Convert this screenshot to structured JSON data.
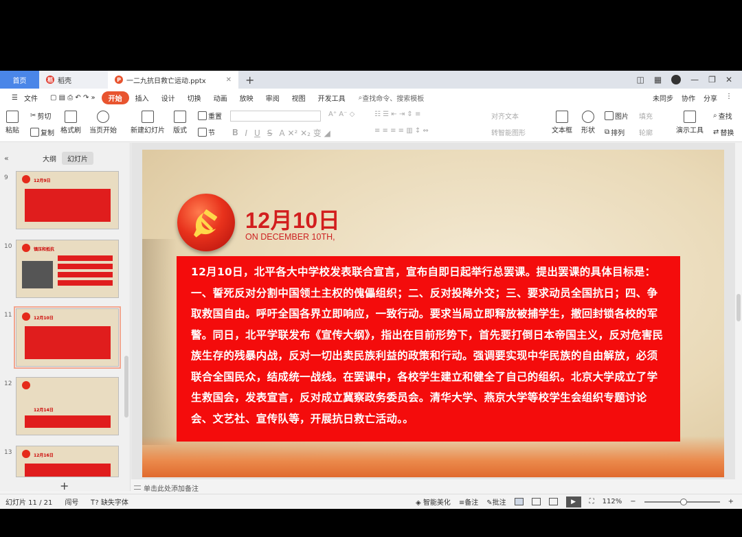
{
  "tabbar": {
    "home": "首页",
    "docer": "稻壳",
    "document": "一二九抗日救亡运动.pptx",
    "plus": "+"
  },
  "menubar": {
    "file": "文件",
    "items": [
      "开始",
      "插入",
      "设计",
      "切换",
      "动画",
      "放映",
      "审阅",
      "视图",
      "开发工具"
    ],
    "search": "查找命令、搜索模板",
    "sync": "未同步",
    "collab": "协作",
    "share": "分享"
  },
  "ribbon": {
    "paste": "粘贴",
    "cut": "剪切",
    "copy": "复制",
    "format_painter": "格式刷",
    "start_from_current": "当页开始",
    "new_slide": "新建幻灯片",
    "layout": "版式",
    "reset": "重置",
    "section": "节",
    "text_direction": "文本框",
    "align_text": "对齐文本",
    "smartart": "转智能图形",
    "textbox": "文本框",
    "shape": "形状",
    "picture": "图片",
    "fill": "填充",
    "arrange": "排列",
    "outline": "轮廓",
    "presentation_tools": "演示工具",
    "find": "查找",
    "replace": "替换"
  },
  "left_panel": {
    "outline_tab": "大纲",
    "slides_tab": "幻灯片",
    "thumbnails": [
      {
        "num": "9",
        "title": "12月9日"
      },
      {
        "num": "10",
        "title": "镇压和抵抗"
      },
      {
        "num": "11",
        "title": "12月10日"
      },
      {
        "num": "12",
        "title": "12月14日"
      },
      {
        "num": "13",
        "title": "12月16日"
      }
    ],
    "add": "+"
  },
  "slide": {
    "date": "12月10日",
    "subtitle": "ON DECEMBER 10TH,",
    "body": "12月10日，北平各大中学校发表联合宣言，宣布自即日起举行总罢课。提出罢课的具体目标是：一、誓死反对分割中国领土主权的傀儡组织；二、反对投降外交；三、要求动员全国抗日；四、争取救国自由。呼吁全国各界立即响应，一致行动。要求当局立即释放被捕学生，撤回封锁各校的军警。同日，北平学联发布《宣传大纲》，指出在目前形势下，首先要打倒日本帝国主义，反对危害民族生存的残暴内战，反对一切出卖民族利益的政策和行动。强调要实现中华民族的自由解放，必须联合全国民众，结成统一战线。在罢课中，各校学生建立和健全了自己的组织。北京大学成立了学生救国会，发表宣言，反对成立冀察政务委员会。清华大学、燕京大学等校学生会组织专题讨论会、文艺社、宣传队等，开展抗日救亡活动。。"
  },
  "notes": "单击此处添加备注",
  "statusbar": {
    "slide_counter": "幻灯片 11 / 21",
    "theme": "闯号",
    "missing_fonts": "缺失字体",
    "beautify": "智能美化",
    "notes": "备注",
    "comments": "批注",
    "zoom": "112%",
    "zoom_level": 0.5
  },
  "colors": {
    "accent": "#e8542f",
    "slide_red": "#f40c0c",
    "title_red": "#d21e1e"
  }
}
